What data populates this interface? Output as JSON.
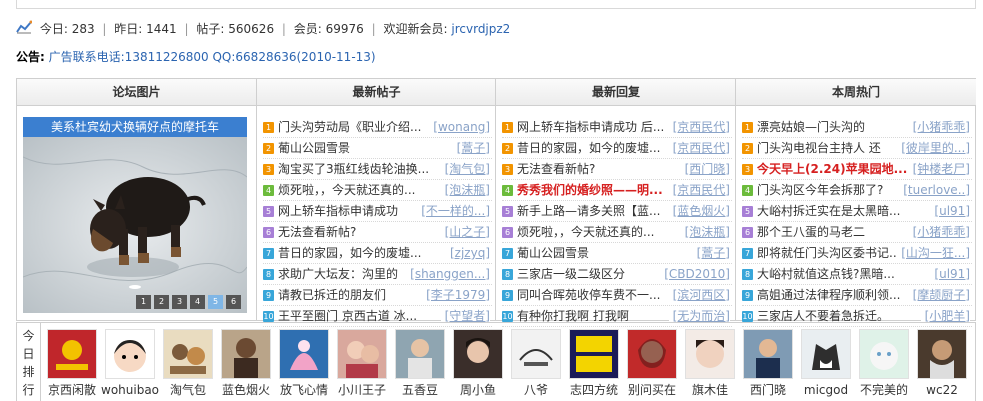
{
  "stats": {
    "today_label": "今日: ",
    "today": "283",
    "yesterday_label": "昨日: ",
    "yesterday": "1441",
    "posts_label": "帖子: ",
    "posts": "560626",
    "members_label": "会员: ",
    "members": "69976",
    "welcome_label": "欢迎新会员: ",
    "new_member": "jrcvrdjpz2"
  },
  "notice": {
    "label": "公告:",
    "text": "广告联系电话:13811226800 QQ:66828636(2010-11-13)"
  },
  "columns": {
    "pics": "论坛图片",
    "latest": "最新帖子",
    "replies": "最新回复",
    "hot": "本周热门"
  },
  "picture": {
    "caption": "美系杜宾幼犬换辆好点的摩托车",
    "pages": [
      "1",
      "2",
      "3",
      "4",
      "5",
      "6"
    ],
    "active_page": 5
  },
  "latest_posts": [
    {
      "n": "1",
      "title": "门头沟劳动局《职业介绍...",
      "author": "[wonang]"
    },
    {
      "n": "2",
      "title": "葡山公园雪景",
      "author": "[蒿子]"
    },
    {
      "n": "3",
      "title": "淘宝买了3瓶红线齿轮油换...",
      "author": "[淘气包]"
    },
    {
      "n": "4",
      "title": "烦死啦，，今天就还真的...",
      "author": "[泡沫瓶]"
    },
    {
      "n": "5",
      "title": "网上轿车指标申请成功",
      "author": "[不一样的...]"
    },
    {
      "n": "6",
      "title": "无法查看新帖?",
      "author": "[山之子]"
    },
    {
      "n": "7",
      "title": "昔日的家园，如今的废墟...",
      "author": "[zjzyq]"
    },
    {
      "n": "8",
      "title": "求助广大坛友：沟里的",
      "author": "[shanggen...]"
    },
    {
      "n": "9",
      "title": "请教已拆迁的朋友们",
      "author": "[李子1979]"
    },
    {
      "n": "10",
      "title": "王平至圈门 京西古道 冰...",
      "author": "[守望者]"
    }
  ],
  "latest_replies": [
    {
      "n": "1",
      "title": "网上轿车指标申请成功 后...",
      "author": "[京西民代]"
    },
    {
      "n": "2",
      "title": "昔日的家园，如今的废墟...",
      "author": "[京西民代]"
    },
    {
      "n": "3",
      "title": "无法查看新帖?",
      "author": "[西门晓]"
    },
    {
      "n": "4",
      "title": "秀秀我们的婚纱照——明...",
      "author": "[京西民代]"
    },
    {
      "n": "5",
      "title": "新手上路—请多关照【蓝...",
      "author": "[蓝色烟火]"
    },
    {
      "n": "6",
      "title": "烦死啦，，今天就还真的...",
      "author": "[泡沫瓶]"
    },
    {
      "n": "7",
      "title": "葡山公园雪景",
      "author": "[蒿子]"
    },
    {
      "n": "8",
      "title": "三家店一级二级区分",
      "author": "[CBD2010]"
    },
    {
      "n": "9",
      "title": "同叫合晖苑收停车费不一...",
      "author": "[滨河西区]"
    },
    {
      "n": "10",
      "title": "有种你打我啊 打我啊",
      "author": "[无为而治]"
    }
  ],
  "weekly_hot": [
    {
      "n": "1",
      "title": "漂亮姑娘—门头沟的",
      "author": "[小猪乖乖]"
    },
    {
      "n": "2",
      "title": "门头沟电视台主持人 还",
      "author": "[彼岸里的...]"
    },
    {
      "n": "3",
      "title": "今天早上(2.24)苹果园地...",
      "author": "[钟楼老尸]"
    },
    {
      "n": "4",
      "title": "门头沟区今年会拆那了?",
      "author": "[tuerlove..]"
    },
    {
      "n": "5",
      "title": "大峪村拆迁实在是太黑暗...",
      "author": "[ul91]"
    },
    {
      "n": "6",
      "title": "那个王八蛋的马老二",
      "author": "[小猪乖乖]"
    },
    {
      "n": "7",
      "title": "即将就任门头沟区委书记...",
      "author": "[山沟一狂...]"
    },
    {
      "n": "8",
      "title": "大峪村就值这点钱?黑暗...",
      "author": "[ul91]"
    },
    {
      "n": "9",
      "title": "高姐通过法律程序顺利领...",
      "author": "[摩颉厨子]"
    },
    {
      "n": "10",
      "title": "三家店人不要着急拆迁。",
      "author": "[小肥羊]"
    }
  ],
  "ranking": {
    "label": "今日排行",
    "users": [
      "京西闲散",
      "wohuibao",
      "淘气包",
      "蓝色烟火",
      "放飞心情",
      "小川王子",
      "五香豆",
      "周小鱼",
      "八爷",
      "志四方统",
      "别问买在",
      "旗木佳",
      "西门晓",
      "micgod",
      "不完美的",
      "wc22"
    ]
  },
  "colors": {
    "link_blue": "#2b64b0",
    "author_blue": "#8aa3c8",
    "hot_red": "#d62020",
    "caption_blue": "#3b7fd0"
  }
}
